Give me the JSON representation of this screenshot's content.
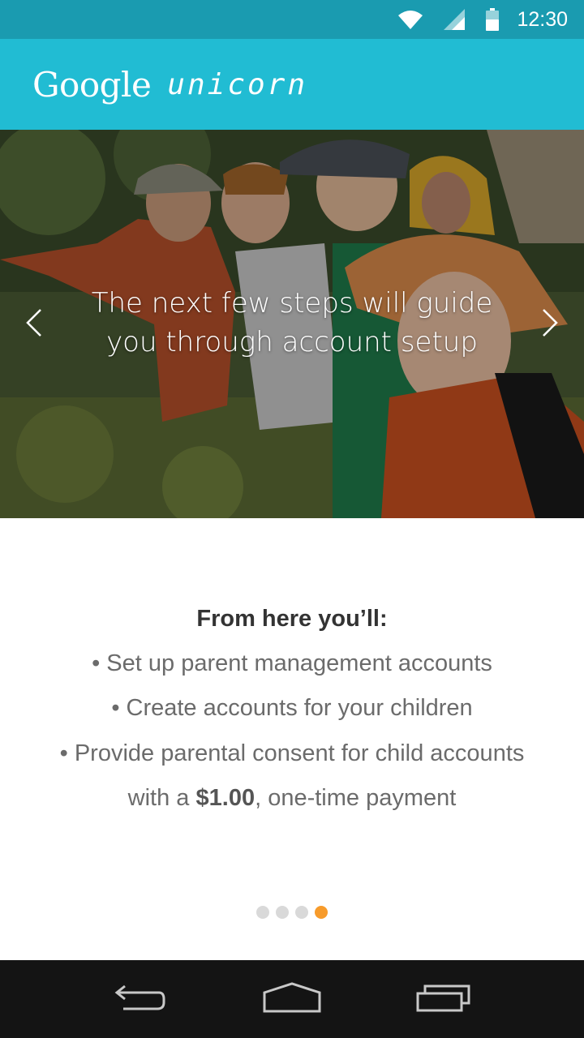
{
  "status_bar": {
    "time": "12:30",
    "icons": [
      "wifi-icon",
      "signal-icon",
      "battery-icon"
    ]
  },
  "app_bar": {
    "logo_brand": "Google",
    "logo_product": "unicorn",
    "color": "#21bcd3"
  },
  "hero": {
    "text_line1": "The next few steps will guide",
    "text_line2": "you through account setup",
    "prev_icon": "chevron-left-icon",
    "next_icon": "chevron-right-icon"
  },
  "content": {
    "heading": "From here you’ll:",
    "item1": "• Set up parent management accounts",
    "item2": "• Create accounts for your children",
    "item3": "• Provide parental consent for child accounts",
    "item4_prefix": "with a ",
    "item4_amount": "$1.00",
    "item4_suffix": ", one-time payment"
  },
  "pager": {
    "total": 4,
    "current": 4,
    "active_color": "#f79b2b"
  },
  "nav_bar": {
    "buttons": [
      "back-icon",
      "home-icon",
      "recents-icon"
    ]
  }
}
